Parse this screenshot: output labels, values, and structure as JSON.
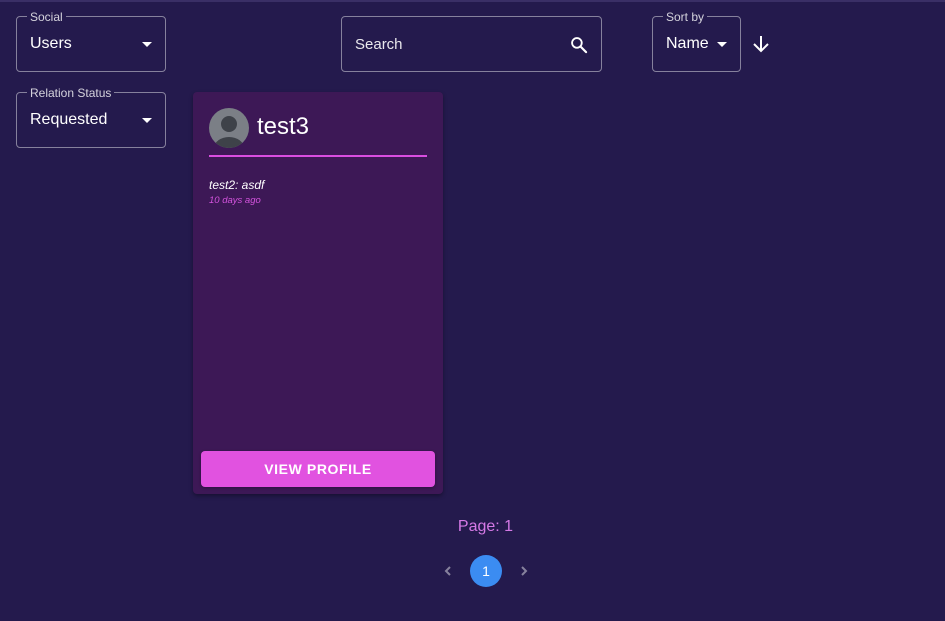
{
  "filters": {
    "social": {
      "label": "Social",
      "value": "Users"
    },
    "relation_status": {
      "label": "Relation Status",
      "value": "Requested"
    }
  },
  "search": {
    "placeholder": "Search"
  },
  "sort": {
    "label": "Sort by",
    "value": "Name",
    "direction": "descending"
  },
  "cards": [
    {
      "username": "test3",
      "message": "test2: asdf",
      "time": "10 days ago",
      "button_label": "VIEW PROFILE"
    }
  ],
  "pagination": {
    "label": "Page: 1",
    "current_page": "1"
  },
  "colors": {
    "background": "#241a4d",
    "card": "#3d1856",
    "accent": "#e152e0",
    "page_label": "#d579e6",
    "active_page": "#3b8cf2"
  },
  "icons": [
    "search-icon",
    "caret-down-icon",
    "arrow-down-icon",
    "user-avatar-icon",
    "chevron-left-icon",
    "chevron-right-icon"
  ]
}
